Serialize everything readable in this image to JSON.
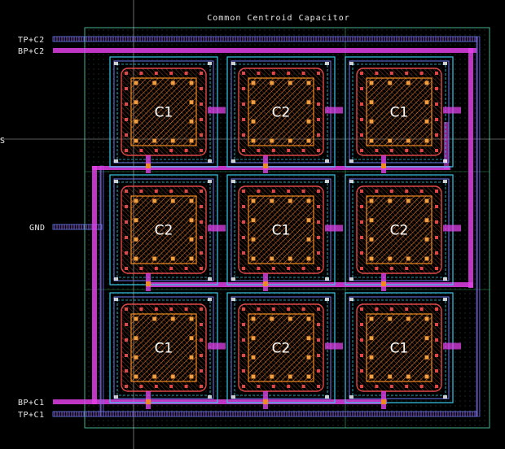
{
  "title": "Common Centroid Capacitor",
  "ports": {
    "tp_c2": "TP+C2",
    "bp_c2": "BP+C2",
    "gnd": "GND",
    "bp_c1": "BP+C1",
    "tp_c1": "TP+C1"
  },
  "side_mark": "S",
  "cells": [
    [
      "C1",
      "C2",
      "C1"
    ],
    [
      "C2",
      "C1",
      "C2"
    ],
    [
      "C1",
      "C2",
      "C1"
    ]
  ],
  "colors": {
    "background": "#000000",
    "metal_magenta": "#e040e8",
    "metal_blue": "#6a7cf0",
    "guard_cyan": "#38c8e8",
    "poly_orange": "#f08a20",
    "boundary_green": "#40c070",
    "crosshair": "#ffffff"
  }
}
